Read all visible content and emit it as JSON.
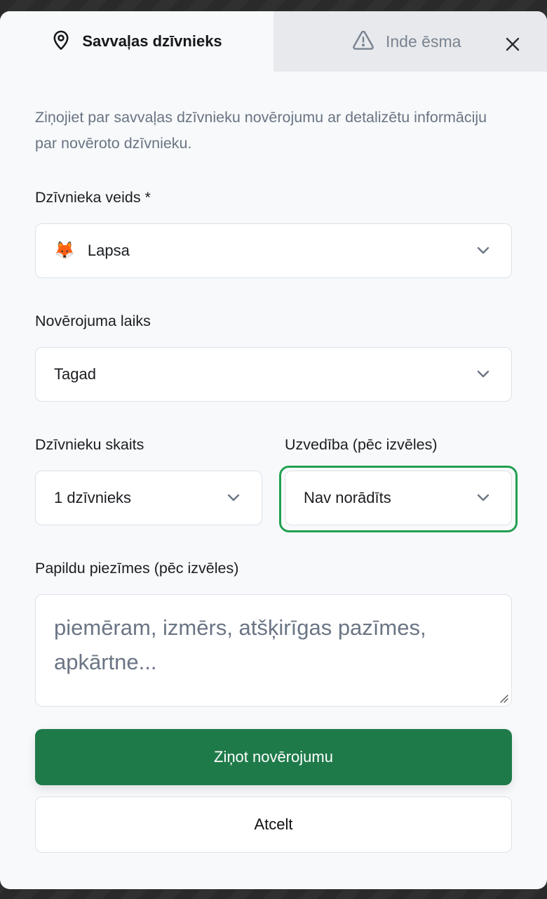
{
  "tabs": {
    "wild_animal_label": "Savvaļas dzīvnieks",
    "incident_label": "Inde ēsma",
    "wild_animal_icon": "map-pin-icon",
    "incident_icon": "warning-icon"
  },
  "close_icon": "close-icon",
  "description": "Ziņojiet par savvaļas dzīvnieku novērojumu ar detalizētu informāciju par novēroto dzīvnieku.",
  "form": {
    "species": {
      "label": "Dzīvnieka veids *",
      "value": "Lapsa",
      "emoji": "🦊"
    },
    "time": {
      "label": "Novērojuma laiks",
      "value": "Tagad"
    },
    "count": {
      "label": "Dzīvnieku skaits",
      "value": "1 dzīvnieks"
    },
    "behavior": {
      "label": "Uzvedība (pēc izvēles)",
      "value": "Nav norādīts"
    },
    "notes": {
      "label": "Papildu piezīmes (pēc izvēles)",
      "placeholder": "piemēram, izmērs, atšķirīgas pazīmes, apkārtne..."
    }
  },
  "actions": {
    "submit_label": "Ziņot novērojumu",
    "cancel_label": "Atcelt"
  },
  "colors": {
    "primary": "#1f7a4a",
    "focus": "#22a052",
    "muted_text": "#6a7482"
  }
}
